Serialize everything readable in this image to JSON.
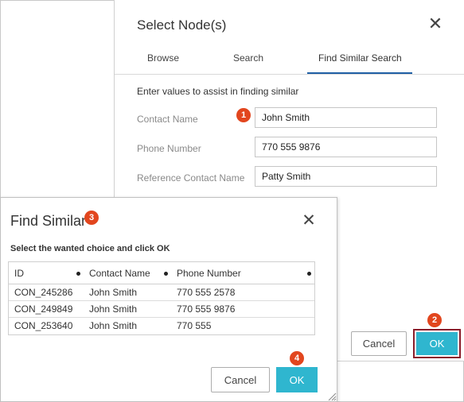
{
  "select_dialog": {
    "title": "Select Node(s)",
    "tabs": [
      {
        "label": "Browse"
      },
      {
        "label": "Search"
      },
      {
        "label": "Find Similar Search"
      }
    ],
    "intro": "Enter values to assist in finding similar",
    "fields": [
      {
        "label": "Contact Name",
        "value": "John Smith"
      },
      {
        "label": "Phone Number",
        "value": "770 555 9876"
      },
      {
        "label": "Reference Contact Name",
        "value": "Patty Smith"
      }
    ],
    "cancel_label": "Cancel",
    "ok_label": "OK"
  },
  "find_similar_dialog": {
    "title": "Find Similar",
    "instruction": "Select the wanted choice and click OK",
    "columns": [
      "ID",
      "Contact Name",
      "Phone Number"
    ],
    "rows": [
      [
        "CON_245286",
        "John Smith",
        "770 555 2578"
      ],
      [
        "CON_249849",
        "John Smith",
        "770 555 9876"
      ],
      [
        "CON_253640",
        "John Smith",
        "770 555"
      ]
    ],
    "cancel_label": "Cancel",
    "ok_label": "OK"
  },
  "badges": {
    "b1": "1",
    "b2": "2",
    "b3": "3",
    "b4": "4"
  },
  "colors": {
    "accent": "#2fb6cf",
    "tab_underline": "#1f5fa5",
    "badge": "#e2461e",
    "highlight_border": "#8b1e2b"
  }
}
